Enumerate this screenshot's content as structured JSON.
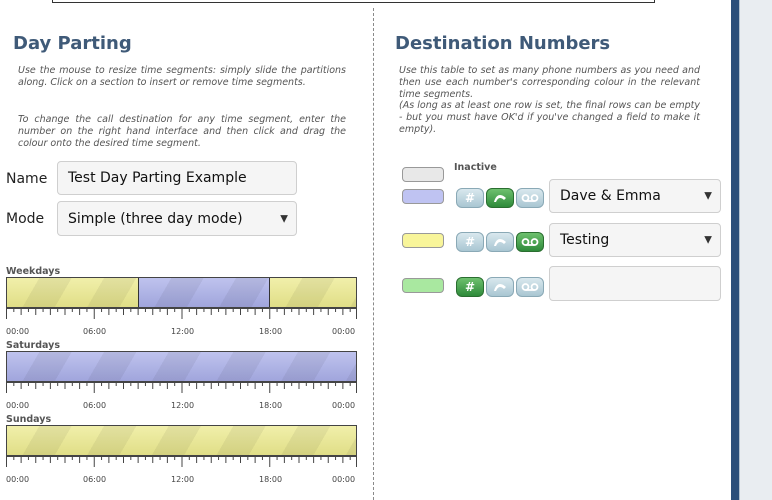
{
  "left": {
    "title": "Day Parting",
    "help1": "Use the mouse to resize time segments: simply slide the partitions along. Click on a section to insert or remove time segments.",
    "help2": "To change the call destination for any time segment, enter the number on the right hand interface and then click and drag the colour onto the desired time segment.",
    "name_label": "Name",
    "name_value": "Test Day Parting Example",
    "mode_label": "Mode",
    "mode_value": "Simple (three day mode)"
  },
  "schedule": {
    "tick_labels": [
      "00:00",
      "06:00",
      "12:00",
      "18:00",
      "00:00"
    ],
    "rows": [
      {
        "label": "Weekdays",
        "segments": [
          {
            "color": "yellow",
            "fraction": 0.375
          },
          {
            "color": "blue",
            "fraction": 0.375
          },
          {
            "color": "yellow",
            "fraction": 0.25
          }
        ]
      },
      {
        "label": "Saturdays",
        "segments": [
          {
            "color": "blue",
            "fraction": 1.0
          }
        ]
      },
      {
        "label": "Sundays",
        "segments": [
          {
            "color": "yellow",
            "fraction": 1.0
          }
        ]
      }
    ]
  },
  "right": {
    "title": "Destination Numbers",
    "help1": "Use this table to set as many phone numbers as you need and then use each number's corresponding colour in the relevant time segments.",
    "help2": "(As long as at least one row is set, the final rows can be empty - but you must have OK'd if you've changed a field to make it empty).",
    "inactive_label": "Inactive",
    "rows": [
      {
        "swatch": "#bfc3f2",
        "active_icon": "phone",
        "value": "Dave & Emma",
        "type": "select"
      },
      {
        "swatch": "#f8f59a",
        "active_icon": "voicemail",
        "value": "Testing",
        "type": "select"
      },
      {
        "swatch": "#a9e8a0",
        "active_icon": "number",
        "value": "",
        "type": "input"
      }
    ]
  },
  "colors": {
    "heading": "#3f5a78",
    "yellow": "#ecea8e",
    "blue": "#a9aee8",
    "inactive": "#e8e8e8"
  }
}
